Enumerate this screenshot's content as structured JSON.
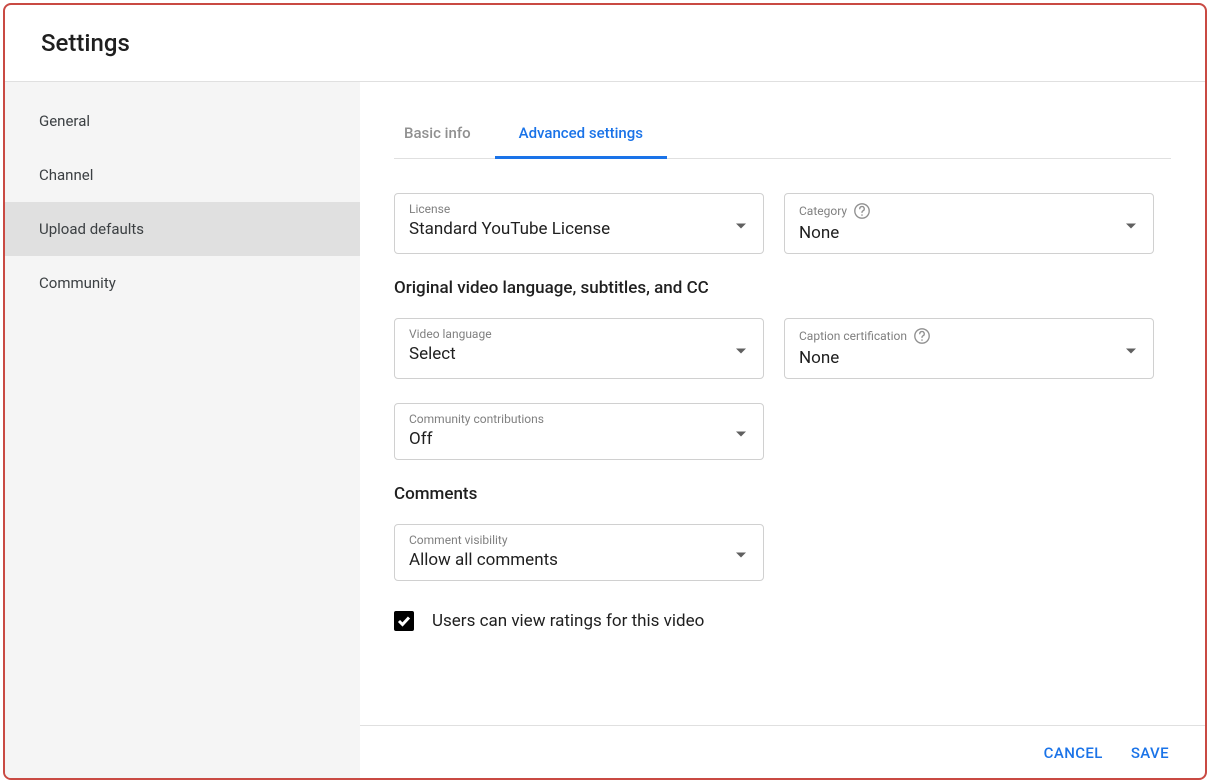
{
  "dialog": {
    "title": "Settings"
  },
  "sidebar": {
    "items": [
      {
        "label": "General"
      },
      {
        "label": "Channel"
      },
      {
        "label": "Upload defaults"
      },
      {
        "label": "Community"
      }
    ]
  },
  "tabs": [
    {
      "label": "Basic info"
    },
    {
      "label": "Advanced settings"
    }
  ],
  "fields": {
    "license": {
      "label": "License",
      "value": "Standard YouTube License"
    },
    "category": {
      "label": "Category",
      "value": "None"
    },
    "languageSection": "Original video language, subtitles, and CC",
    "videoLanguage": {
      "label": "Video language",
      "value": "Select"
    },
    "captionCert": {
      "label": "Caption certification",
      "value": "None"
    },
    "communityContrib": {
      "label": "Community contributions",
      "value": "Off"
    },
    "commentsSection": "Comments",
    "commentVisibility": {
      "label": "Comment visibility",
      "value": "Allow all comments"
    },
    "ratingsCheckbox": "Users can view ratings for this video"
  },
  "footer": {
    "cancel": "CANCEL",
    "save": "SAVE"
  }
}
